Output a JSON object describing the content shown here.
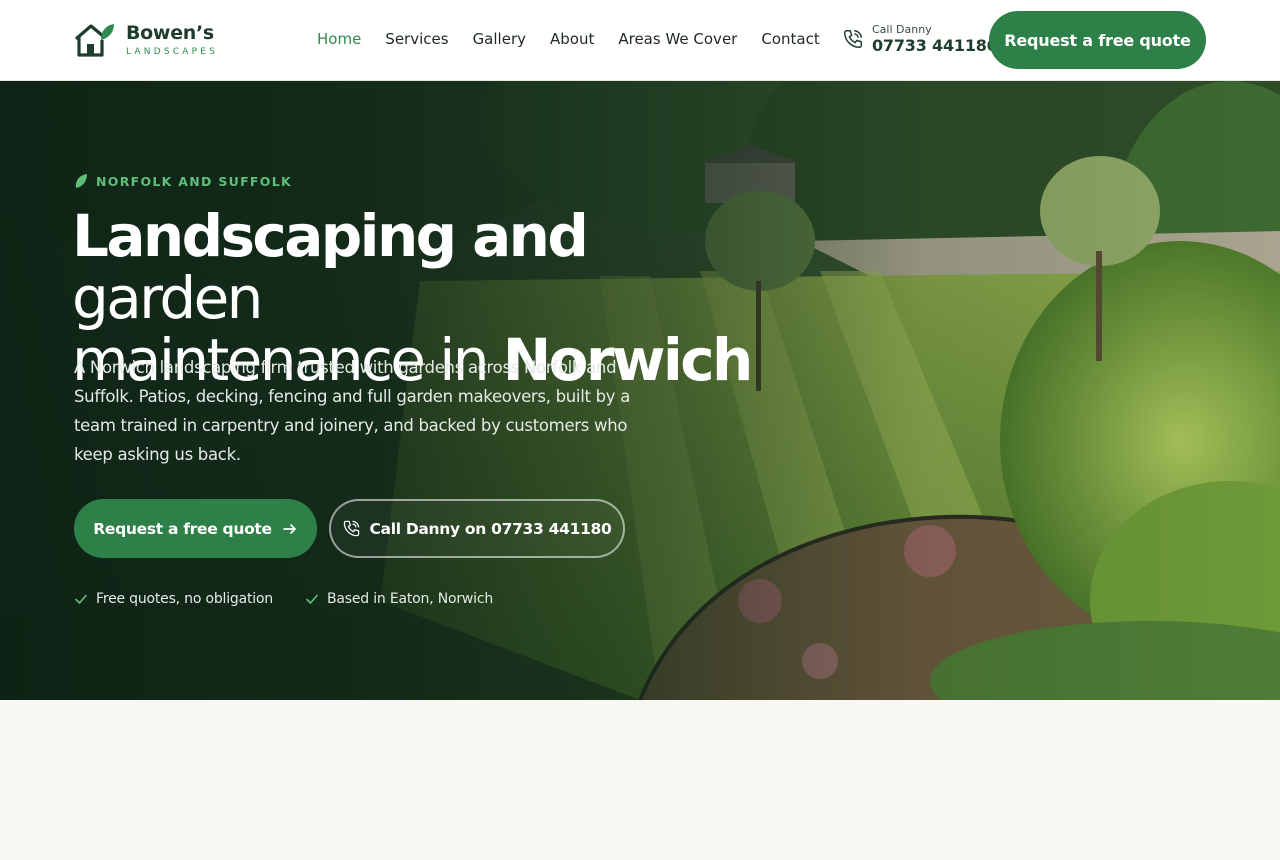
{
  "brand": {
    "name": "Bowen’s",
    "subtitle": "LANDSCAPES",
    "accent": "#2e8049",
    "dark": "#1f3d2c"
  },
  "nav": {
    "items": [
      {
        "label": "Home",
        "active": true
      },
      {
        "label": "Services",
        "active": false
      },
      {
        "label": "Gallery",
        "active": false
      },
      {
        "label": "About",
        "active": false
      },
      {
        "label": "Areas We Cover",
        "active": false
      },
      {
        "label": "Contact",
        "active": false
      }
    ]
  },
  "header_call": {
    "label": "Call Danny",
    "number": "07733 441180",
    "icon": "phone-icon"
  },
  "header_cta": {
    "label": "Request a free quote"
  },
  "hero": {
    "eyebrow": "NORFOLK AND SUFFOLK",
    "title_parts": {
      "p1": "Landscaping and",
      "p2": "garden",
      "p3": "maintenance in",
      "p4": "Norwich"
    },
    "description": "A Norwich landscaping firm trusted with gardens across Norfolk and Suffolk. Patios, decking, fencing and full garden makeovers, built by a team trained in carpentry and joinery, and backed by customers who keep asking us back.",
    "primary_button": "Request a free quote",
    "secondary_button": "Call Danny on 07733 441180",
    "trust": [
      "Free quotes, no obligation",
      "Based in Eaton, Norwich"
    ]
  }
}
